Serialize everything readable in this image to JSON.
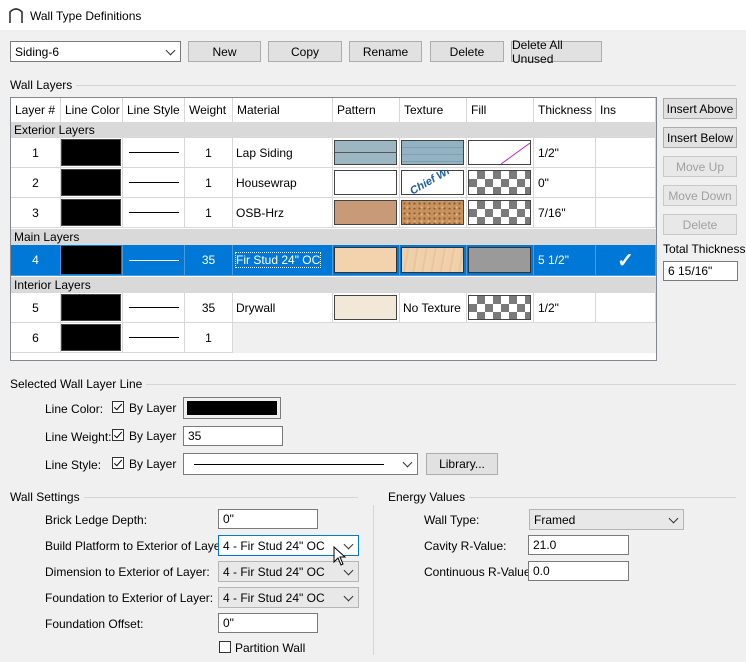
{
  "window": {
    "title": "Wall Type Definitions"
  },
  "toolbar": {
    "wall_type_value": "Siding-6",
    "new_label": "New",
    "copy_label": "Copy",
    "rename_label": "Rename",
    "delete_label": "Delete",
    "delete_all_unused_label": "Delete All Unused"
  },
  "wall_layers": {
    "group_title": "Wall Layers",
    "columns": [
      "Layer #",
      "Line Color",
      "Line Style",
      "Weight",
      "Material",
      "Pattern",
      "Texture",
      "Fill",
      "Thickness",
      "Ins"
    ],
    "sections": {
      "exterior": "Exterior Layers",
      "main": "Main Layers",
      "interior": "Interior Layers"
    },
    "rows": [
      {
        "num": "1",
        "weight": "1",
        "material": "Lap Siding",
        "thickness": "1/2\"",
        "pattern_color": "#9cb6c2",
        "texture_color": "#8fb0c0",
        "fill": "diagonal",
        "texture_text": ""
      },
      {
        "num": "2",
        "weight": "1",
        "material": "Housewrap",
        "thickness": "0\"",
        "pattern_color": "#ffffff",
        "texture_color": "#ffffff",
        "fill": "checker",
        "texture_text": "Chief Wr"
      },
      {
        "num": "3",
        "weight": "1",
        "material": "OSB-Hrz",
        "thickness": "7/16\"",
        "pattern_color": "#c99a78",
        "texture_color": "#c8925e",
        "fill": "checker",
        "texture_text": ""
      },
      {
        "num": "4",
        "weight": "35",
        "material": "Fir Stud 24\" OC",
        "thickness": "5 1/2\"",
        "pattern_color": "#f2d3ae",
        "texture_color": "#efd0aa",
        "fill": "gray",
        "ins": "✓",
        "texture_text": ""
      },
      {
        "num": "5",
        "weight": "35",
        "material": "Drywall",
        "thickness": "1/2\"",
        "pattern_color": "#f1e8d8",
        "texture_label": "No Texture",
        "fill": "checker",
        "texture_text": ""
      },
      {
        "num": "6",
        "weight": "1"
      }
    ]
  },
  "side_buttons": {
    "insert_above": "Insert Above",
    "insert_below": "Insert Below",
    "move_up": "Move Up",
    "move_down": "Move Down",
    "delete": "Delete",
    "total_thickness_label": "Total Thickness:",
    "total_thickness_value": "6 15/16\""
  },
  "selected_line": {
    "group_title": "Selected Wall Layer Line",
    "line_color_label": "Line Color:",
    "line_weight_label": "Line Weight:",
    "line_style_label": "Line Style:",
    "by_layer": "By Layer",
    "line_weight_value": "35",
    "library_label": "Library...",
    "line_color_value": "#000000"
  },
  "wall_settings": {
    "group_title": "Wall Settings",
    "brick_ledge_label": "Brick Ledge Depth:",
    "brick_ledge_value": "0\"",
    "build_platform_label": "Build Platform to Exterior of Layer:",
    "build_platform_value": "4 - Fir Stud 24\" OC",
    "dimension_label": "Dimension to Exterior of Layer:",
    "dimension_value": "4 - Fir Stud 24\" OC",
    "foundation_label": "Foundation to Exterior of Layer:",
    "foundation_value": "4 - Fir Stud 24\" OC",
    "foundation_offset_label": "Foundation Offset:",
    "foundation_offset_value": "0\"",
    "partition_wall_label": "Partition Wall"
  },
  "energy": {
    "group_title": "Energy Values",
    "wall_type_label": "Wall Type:",
    "wall_type_value": "Framed",
    "cavity_label": "Cavity R-Value:",
    "cavity_value": "21.0",
    "continuous_label": "Continuous R-Value:",
    "continuous_value": "0.0"
  }
}
